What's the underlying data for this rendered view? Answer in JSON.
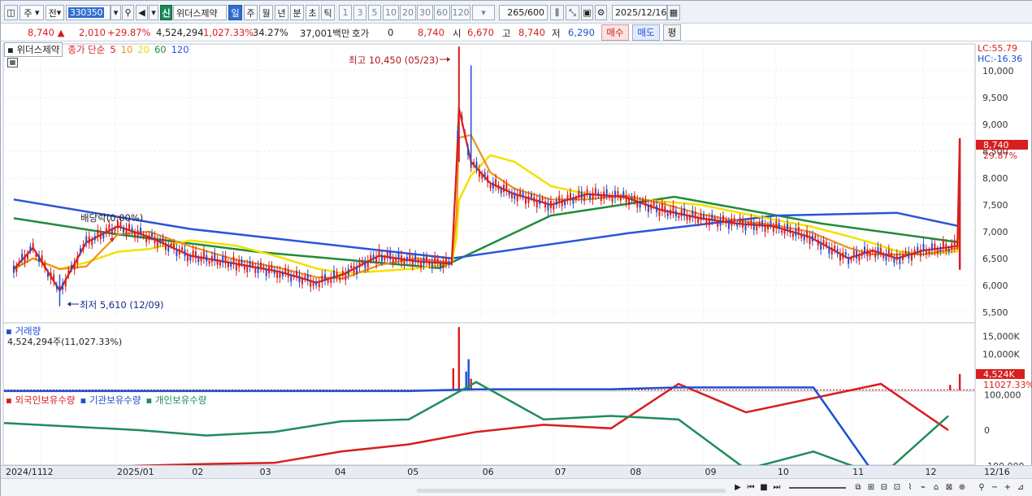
{
  "toolbar": {
    "market_label": "주",
    "prev_label": "전",
    "stock_code": "330350",
    "shin_badge": "신",
    "stock_name": "위더스제약",
    "periods": [
      {
        "label": "일",
        "active": true
      },
      {
        "label": "주",
        "active": false
      },
      {
        "label": "월",
        "active": false
      },
      {
        "label": "년",
        "active": false
      },
      {
        "label": "분",
        "active": false
      },
      {
        "label": "초",
        "active": false
      },
      {
        "label": "틱",
        "active": false
      }
    ],
    "tick_options": [
      "1",
      "3",
      "5",
      "10",
      "20",
      "30",
      "60",
      "120"
    ],
    "bar_count": "265",
    "bar_total": "/600",
    "date": "2025/12/16"
  },
  "quote": {
    "price": "8,740",
    "change": "2,010",
    "change_pct": "+29.87%",
    "volume": "4,524,294",
    "volume_ratio": "1,027.33%",
    "turnover": "34.27%",
    "amount": "37,001백만",
    "hoga_label": "호가",
    "hoga_value": "0",
    "hoga_price": "8,740",
    "open_label": "시",
    "open_value": "6,670",
    "high_label": "고",
    "high_value": "8,740",
    "low_label": "저",
    "low_value": "6,290",
    "buy_label": "매수",
    "sell_label": "매도",
    "flat_label": "평"
  },
  "chart": {
    "legend_name": "위더스제약",
    "legend_ma_title": "종가 단순",
    "ma_periods": [
      {
        "label": "5",
        "color": "#d81e1e"
      },
      {
        "label": "10",
        "color": "#f09018"
      },
      {
        "label": "20",
        "color": "#e8d800"
      },
      {
        "label": "60",
        "color": "#1e8c3a"
      },
      {
        "label": "120",
        "color": "#2a55d8"
      }
    ],
    "lc_label": "LC:55.79",
    "hc_label": "HC:-16.36",
    "high_annotation": "최고 10,450 (05/23)",
    "low_annotation": "최저 5,610 (12/09)",
    "dividend_annotation": "배당락(0.00%)",
    "price_badge": "8,740",
    "price_pct": "29.87%",
    "volume_title": "거래량",
    "volume_value": "4,524,294주(11,027.33%)",
    "volume_badge": "4,524K",
    "volume_pct": "11027.33%",
    "holding_legend": [
      {
        "label": "외국인보유수량",
        "color": "#d81e1e"
      },
      {
        "label": "기관보유수량",
        "color": "#1c4fd1"
      },
      {
        "label": "개인보유수량",
        "color": "#1e8c5a"
      }
    ]
  },
  "chart_data": [
    {
      "type": "candlestick",
      "title": "위더스제약 종가 단순 5 10 20 60 120",
      "ylim": [
        5300,
        10500
      ],
      "y_ticks": [
        "10,000",
        "9,500",
        "9,000",
        "8,500",
        "8,000",
        "7,500",
        "7,000",
        "6,500",
        "6,000",
        "5,500"
      ],
      "x_ticks": [
        "2024/11",
        "12",
        "2025/01",
        "02",
        "03",
        "04",
        "05",
        "06",
        "07",
        "08",
        "09",
        "10",
        "11",
        "12",
        "12/16"
      ],
      "close_series": [
        [
          "2024-11-20",
          6300
        ],
        [
          "2024-11-28",
          6700
        ],
        [
          "2024-12-09",
          5900
        ],
        [
          "2024-12-20",
          6800
        ],
        [
          "2025-01-02",
          7100
        ],
        [
          "2025-01-15",
          6900
        ],
        [
          "2025-02-01",
          6550
        ],
        [
          "2025-02-20",
          6400
        ],
        [
          "2025-03-10",
          6250
        ],
        [
          "2025-03-25",
          6050
        ],
        [
          "2025-04-05",
          6200
        ],
        [
          "2025-04-20",
          6550
        ],
        [
          "2025-05-05",
          6450
        ],
        [
          "2025-05-20",
          6400
        ],
        [
          "2025-05-22",
          8200
        ],
        [
          "2025-05-23",
          9300
        ],
        [
          "2025-05-28",
          8300
        ],
        [
          "2025-06-05",
          7900
        ],
        [
          "2025-06-15",
          7700
        ],
        [
          "2025-06-30",
          7500
        ],
        [
          "2025-07-15",
          7700
        ],
        [
          "2025-07-30",
          7650
        ],
        [
          "2025-08-15",
          7400
        ],
        [
          "2025-08-31",
          7250
        ],
        [
          "2025-09-15",
          7150
        ],
        [
          "2025-09-30",
          7100
        ],
        [
          "2025-10-15",
          6900
        ],
        [
          "2025-10-31",
          6500
        ],
        [
          "2025-11-10",
          6650
        ],
        [
          "2025-11-20",
          6500
        ],
        [
          "2025-12-01",
          6650
        ],
        [
          "2025-12-15",
          6730
        ],
        [
          "2025-12-16",
          8740
        ]
      ],
      "ma_series": [
        {
          "name": "60",
          "values": [
            [
              "2024-11-20",
              7250
            ],
            [
              "2025-01-02",
              6950
            ],
            [
              "2025-03-01",
              6620
            ],
            [
              "2025-05-15",
              6320
            ],
            [
              "2025-06-30",
              7300
            ],
            [
              "2025-08-20",
              7650
            ],
            [
              "2025-10-20",
              7150
            ],
            [
              "2025-12-16",
              6800
            ]
          ]
        },
        {
          "name": "120",
          "values": [
            [
              "2024-11-20",
              7600
            ],
            [
              "2025-02-01",
              7050
            ],
            [
              "2025-05-20",
              6500
            ],
            [
              "2025-08-01",
              6970
            ],
            [
              "2025-10-01",
              7300
            ],
            [
              "2025-11-20",
              7350
            ],
            [
              "2025-12-16",
              7100
            ]
          ]
        }
      ],
      "annotations": {
        "high": {
          "date": "05/23",
          "value": 10450
        },
        "low": {
          "date": "12/09",
          "value": 5610
        }
      }
    },
    {
      "type": "bar",
      "title": "거래량",
      "ylim": [
        0,
        18000
      ],
      "y_ticks": [
        "15,000K",
        "10,000K"
      ],
      "values": [
        [
          "2025-05-22",
          6100
        ],
        [
          "2025-05-23",
          17500
        ],
        [
          "2025-05-26",
          5200
        ],
        [
          "2025-05-27",
          8600
        ],
        [
          "2025-05-28",
          3200
        ],
        [
          "2025-12-12",
          1500
        ],
        [
          "2025-12-16",
          4524
        ]
      ]
    },
    {
      "type": "line",
      "title": "보유수량",
      "ylim": [
        -160000,
        160000
      ],
      "y_ticks": [
        "100,000",
        "0",
        "-100,000"
      ],
      "series": [
        {
          "name": "외국인보유수량",
          "values": [
            -110000,
            -108000,
            -100000,
            -95000,
            -92000,
            -60000,
            -40000,
            -5000,
            15000,
            5000,
            130000,
            50000,
            90000,
            130000,
            0
          ]
        },
        {
          "name": "기관보유수량",
          "values": [
            110000,
            110000,
            110000,
            110000,
            110000,
            110000,
            110000,
            115000,
            115000,
            115000,
            120000,
            120000,
            120000,
            -150000,
            -150000
          ]
        },
        {
          "name": "개인보유수량",
          "values": [
            20000,
            10000,
            0,
            -15000,
            -5000,
            25000,
            30000,
            135000,
            30000,
            40000,
            30000,
            -110000,
            -60000,
            -130000,
            40000
          ]
        }
      ]
    }
  ],
  "date_axis": [
    "2024/11",
    "12",
    "2025/01",
    "02",
    "03",
    "04",
    "05",
    "06",
    "07",
    "08",
    "09",
    "10",
    "11",
    "12",
    "12/16"
  ]
}
